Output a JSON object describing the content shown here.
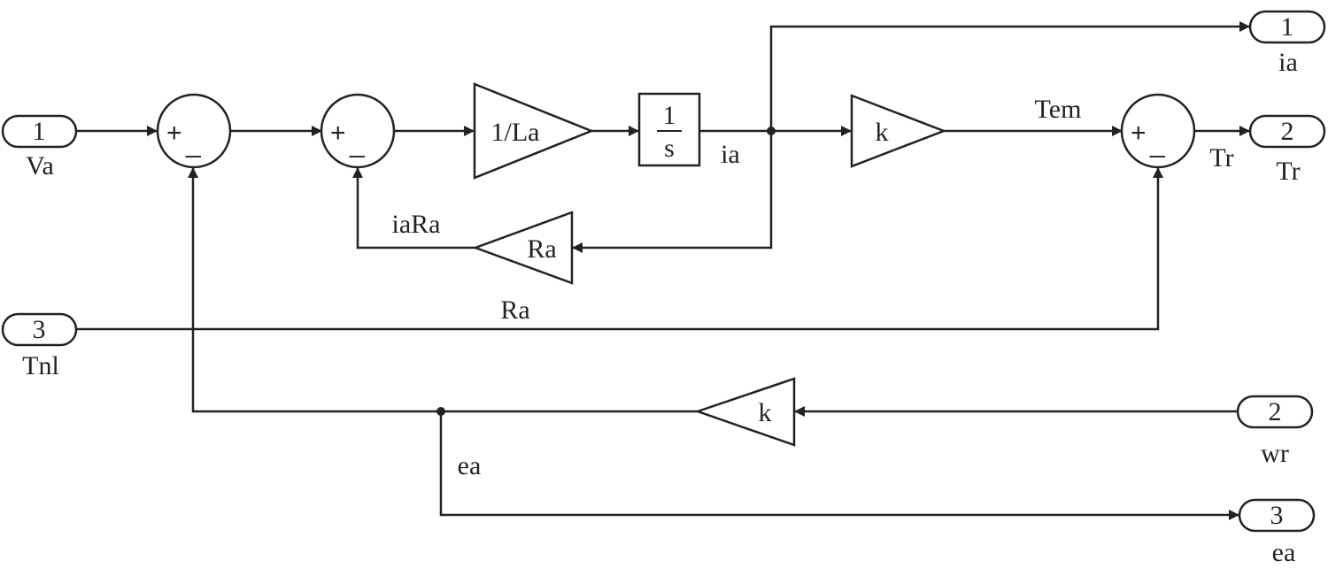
{
  "inports": [
    {
      "number": "1",
      "name": "Va"
    },
    {
      "number": "2",
      "name": "wr"
    },
    {
      "number": "3",
      "name": "Tnl"
    }
  ],
  "outports": [
    {
      "number": "1",
      "name": "ia"
    },
    {
      "number": "2",
      "name": "Tr"
    },
    {
      "number": "3",
      "name": "ea"
    }
  ],
  "blocks": {
    "gain_inv_la": "1/La",
    "integrator_num": "1",
    "integrator_den": "s",
    "gain_k_torque": "k",
    "gain_ra": "Ra",
    "gain_ra_name": "Ra",
    "gain_k_emf": "k",
    "sum_plus": "+",
    "sum_minus": "_"
  },
  "signals": {
    "ia": "ia",
    "tem": "Tem",
    "tr": "Tr",
    "iara": "iaRa",
    "ea": "ea"
  }
}
